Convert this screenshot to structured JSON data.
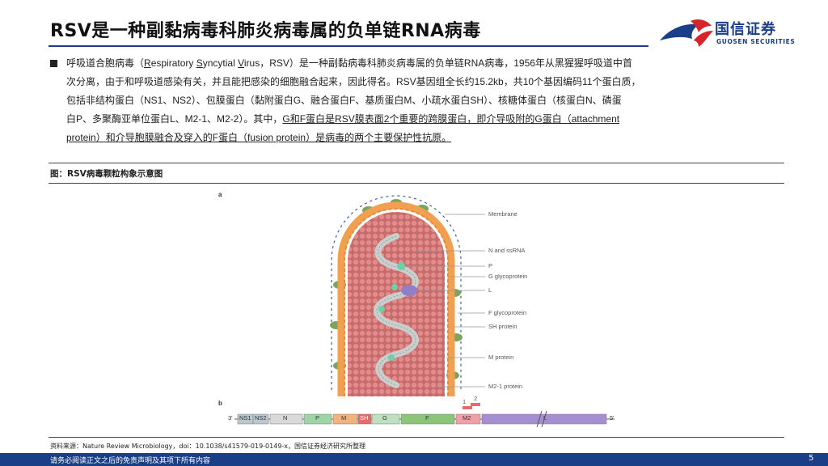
{
  "header": {
    "title": "RSV是一种副黏病毒科肺炎病毒属的负单链RNA病毒",
    "logo_cn": "国信证券",
    "logo_en": "GUOSEN SECURITIES"
  },
  "body": {
    "lines": [
      [
        "呼吸道合胞病毒（",
        "R",
        "espiratory  ",
        "S",
        "yncytial  ",
        "V",
        "irus，RSV）是一种副黏病毒科肺炎病毒属的负单链RNA病毒，1956年从黑猩猩呼吸道中首"
      ],
      "次分离，由于和呼吸道感染有关，并且能把感染的细胞融合起来，因此得名。RSV基因组全长约15.2kb，共10个基因编码11个蛋白质，",
      "包括非结构蛋白（NS1、NS2）、包膜蛋白（黏附蛋白G、融合蛋白F、基质蛋白M、小疏水蛋白SH）、核糖体蛋白（核蛋白N、磷蛋",
      [
        "白P、多聚酶亚单位蛋白L、M2-1、M2-2）。其中，",
        "G和F蛋白是RSV膜表面2个重要的跨膜蛋白，即介导吸附的G蛋白（attachment"
      ],
      "protein）和介导胞膜融合及穿入的F蛋白（fusion protein）是病毒的两个主要保护性抗原。"
    ]
  },
  "figure": {
    "caption": "图：RSV病毒颗粒构象示意图",
    "panel_a": "a",
    "panel_b": "b",
    "labels": [
      "Membrane",
      "N and ssRNA",
      "P",
      "G glycoprotein",
      "L",
      "F glycoprotein",
      "SH protein",
      "M protein",
      "M2-1 protein"
    ],
    "genome": {
      "left_end": "3'",
      "right_end": "5'",
      "genes": [
        "NS1",
        "NS2",
        "N",
        "P",
        "M",
        "SH",
        "G",
        "F",
        "M2",
        "L"
      ],
      "orf_labels": [
        "1",
        "2"
      ]
    },
    "colors": {
      "membrane": "#f0a050",
      "matrix": "#d86f6f",
      "nucleocapsid": "#c8cfcc",
      "glycoprotein": "#7aa55a",
      "polymerase": "#8f7ec8"
    }
  },
  "footer": {
    "source": "资料来源：Nature Review Microbiology，doi：10.1038/s41579-019-0149-x，国信证券经济研究所整理",
    "disclaimer": "请务必阅读正文之后的免责声明及其项下所有内容",
    "page": "5"
  }
}
